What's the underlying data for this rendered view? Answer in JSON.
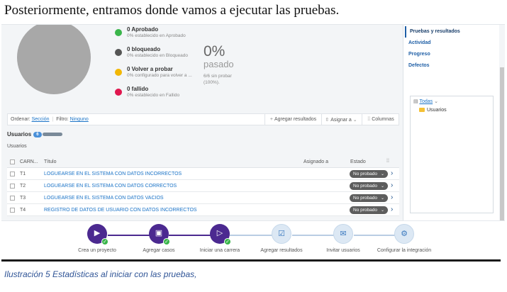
{
  "document": {
    "heading": "Posteriormente, entramos donde vamos a ejecutar las pruebas.",
    "caption": "Ilustración 5 Estadísticas al iniciar con las pruebas,"
  },
  "stats": {
    "legend": [
      {
        "title": "0 Aprobado",
        "sub": "0% establecido en Aprobado",
        "color": "#3ab54a"
      },
      {
        "title": "0 bloqueado",
        "sub": "0% establecido en Bloqueado",
        "color": "#555555"
      },
      {
        "title": "0 Volver a probar",
        "sub": "0% configurado para volver a ...",
        "color": "#f2b705"
      },
      {
        "title": "0 fallido",
        "sub": "0% establecido en Fallido",
        "color": "#e0174f"
      }
    ],
    "percent": "0%",
    "percent_label": "pasado",
    "untested": "6/6 sin probar (100%)."
  },
  "toolbar": {
    "order_label": "Ordenar:",
    "order_value": "Sección",
    "filter_label": "Filtro:",
    "filter_value": "Ninguno",
    "add_results": "Agregar resultados",
    "assign": "Asignar a",
    "columns": "Columnas"
  },
  "group": {
    "title": "Usuarios",
    "count": "6",
    "label": "Usuarios"
  },
  "table": {
    "headers": {
      "id": "CARN...",
      "title": "Título",
      "assigned": "Asignado a",
      "state": "Estado"
    },
    "rows": [
      {
        "id": "T1",
        "title": "LOGUEARSE EN EL SISTEMA CON DATOS INCORRECTOS",
        "state": "No probado"
      },
      {
        "id": "T2",
        "title": "LOGUEARSE EN EL SISTEMA CON DATOS CORRECTOS",
        "state": "No probado"
      },
      {
        "id": "T3",
        "title": "LOGUEARSE EN EL SISTEMA CON DATOS VACIOS",
        "state": "No probado"
      },
      {
        "id": "T4",
        "title": "REGISTRO DE DATOS DE USUARIO CON DATOS INCORRECTOS",
        "state": "No probado"
      }
    ]
  },
  "sidebar": {
    "items": [
      {
        "label": "Pruebas y resultados"
      },
      {
        "label": "Actividad"
      },
      {
        "label": "Progreso"
      },
      {
        "label": "Defectos"
      }
    ],
    "tree_filter": "Todas",
    "tree_item": "Usuarios"
  },
  "onboarding": {
    "steps": [
      {
        "label": "Crea un proyecto",
        "done": true,
        "icon": "project-icon"
      },
      {
        "label": "Agregar casos",
        "done": true,
        "icon": "add-cases-icon"
      },
      {
        "label": "Iniciar una carrera",
        "done": true,
        "icon": "run-icon"
      },
      {
        "label": "Agregar resultados",
        "done": false,
        "icon": "results-icon"
      },
      {
        "label": "Invitar usuarios",
        "done": false,
        "icon": "invite-icon"
      },
      {
        "label": "Configurar la integración",
        "done": false,
        "icon": "integration-icon"
      }
    ]
  },
  "colors": {
    "accent": "#4b2990",
    "link": "#1a73c7",
    "passed": "#3ab54a"
  }
}
